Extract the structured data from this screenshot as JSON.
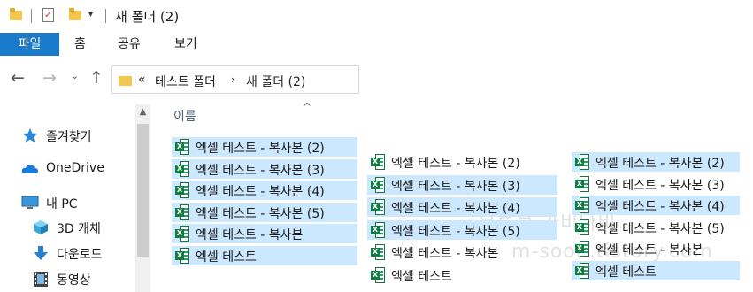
{
  "window": {
    "title": "새 폴더 (2)",
    "quick_access": [
      "folder-icon",
      "properties-check-icon",
      "new-folder-icon",
      "customize-dropdown-icon"
    ]
  },
  "ribbon": {
    "tabs": [
      "파일",
      "홈",
      "공유",
      "보기"
    ],
    "active_tab_color": "#1979ca"
  },
  "address": {
    "overflow": "«",
    "crumbs": [
      "테스트 폴더",
      "새 폴더 (2)"
    ]
  },
  "navigation": [
    {
      "label": "즐겨찾기",
      "icon": "star-icon"
    },
    {
      "label": "OneDrive",
      "icon": "cloud-icon"
    },
    {
      "label": "내 PC",
      "icon": "monitor-icon"
    },
    {
      "label": "3D 개체",
      "icon": "cube-icon"
    },
    {
      "label": "다운로드",
      "icon": "download-arrow-icon"
    },
    {
      "label": "동영상",
      "icon": "film-icon"
    }
  ],
  "file_list": {
    "column_header": "이름",
    "selection_color": "#cce8ff",
    "columns": [
      {
        "files": [
          {
            "name": "엑셀 테스트 - 복사본 (2)",
            "selected": true
          },
          {
            "name": "엑셀 테스트 - 복사본 (3)",
            "selected": true
          },
          {
            "name": "엑셀 테스트 - 복사본 (4)",
            "selected": true
          },
          {
            "name": "엑셀 테스트 - 복사본 (5)",
            "selected": true
          },
          {
            "name": "엑셀 테스트 - 복사본",
            "selected": true
          },
          {
            "name": "엑셀 테스트",
            "selected": true
          }
        ]
      },
      {
        "files": [
          {
            "name": "엑셀 테스트 - 복사본 (2)",
            "selected": false
          },
          {
            "name": "엑셀 테스트 - 복사본 (3)",
            "selected": true
          },
          {
            "name": "엑셀 테스트 - 복사본 (4)",
            "selected": true
          },
          {
            "name": "엑셀 테스트 - 복사본 (5)",
            "selected": true
          },
          {
            "name": "엑셀 테스트 - 복사본",
            "selected": false
          },
          {
            "name": "엑셀 테스트",
            "selected": false
          }
        ]
      },
      {
        "files": [
          {
            "name": "엑셀 테스트 - 복사본 (2)",
            "selected": true
          },
          {
            "name": "엑셀 테스트 - 복사본 (3)",
            "selected": false
          },
          {
            "name": "엑셀 테스트 - 복사본 (4)",
            "selected": true
          },
          {
            "name": "엑셀 테스트 - 복사본 (5)",
            "selected": false
          },
          {
            "name": "엑셀 테스트 - 복사본",
            "selected": false
          },
          {
            "name": "엑셀 테스트",
            "selected": true
          }
        ]
      }
    ]
  },
  "watermark": {
    "line1": "유튜브 가비나비",
    "line2": "m-soon.tistory.com"
  }
}
